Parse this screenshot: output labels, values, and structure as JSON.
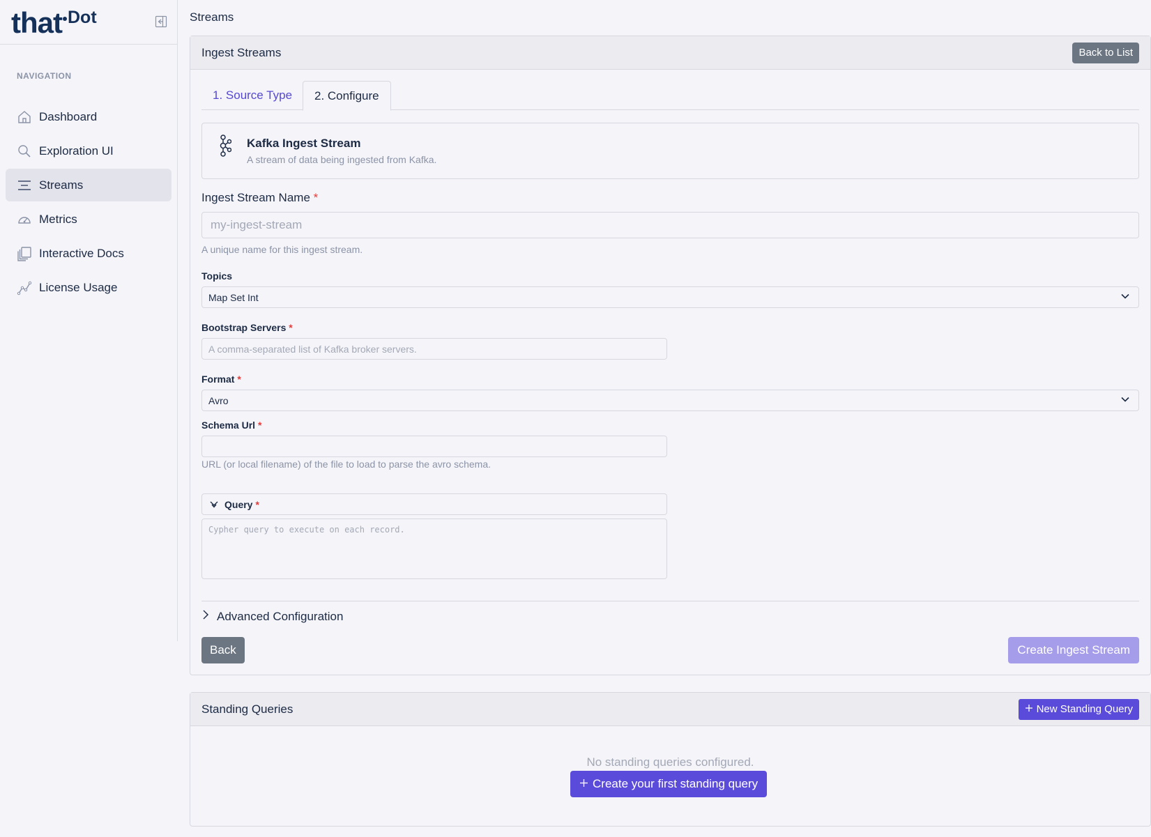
{
  "brand": {
    "logo_main": "that",
    "logo_sup": "Dot"
  },
  "sidebar": {
    "header": "NAVIGATION",
    "items": [
      {
        "label": "Dashboard",
        "icon": "home-icon",
        "active": false
      },
      {
        "label": "Exploration UI",
        "icon": "search-icon",
        "active": false
      },
      {
        "label": "Streams",
        "icon": "streams-icon",
        "active": true
      },
      {
        "label": "Metrics",
        "icon": "gauge-icon",
        "active": false
      },
      {
        "label": "Interactive Docs",
        "icon": "docs-icon",
        "active": false
      },
      {
        "label": "License Usage",
        "icon": "chart-line-icon",
        "active": false
      }
    ]
  },
  "breadcrumb": "Streams",
  "ingest": {
    "title": "Ingest Streams",
    "back_to_list": "Back to List",
    "tabs": [
      {
        "label": "1. Source Type"
      },
      {
        "label": "2. Configure"
      }
    ],
    "source": {
      "title": "Kafka Ingest Stream",
      "description": "A stream of data being ingested from Kafka."
    },
    "name_field": {
      "label": "Ingest Stream Name",
      "required_mark": "*",
      "placeholder": "my-ingest-stream",
      "help": "A unique name for this ingest stream."
    },
    "topics": {
      "label": "Topics",
      "value": "Map Set Int"
    },
    "bootstrap": {
      "label": "Bootstrap Servers",
      "required_mark": "*",
      "placeholder": "A comma-separated list of Kafka broker servers."
    },
    "format": {
      "label": "Format",
      "required_mark": "*",
      "value": "Avro"
    },
    "schema_url": {
      "label": "Schema Url",
      "required_mark": "*",
      "value": "",
      "help": "URL (or local filename) of the file to load to parse the avro schema."
    },
    "query": {
      "label": "Query",
      "required_mark": "*",
      "placeholder": "Cypher query to execute on each record."
    },
    "advanced": "Advanced Configuration",
    "back_button": "Back",
    "create_button": "Create Ingest Stream"
  },
  "standing": {
    "title": "Standing Queries",
    "new_button": "New Standing Query",
    "empty_message": "No standing queries configured.",
    "create_first": "Create your first standing query"
  },
  "colors": {
    "accent": "#5b4bdb",
    "accent_disabled": "#a59cea",
    "secondary": "#6c7683",
    "required": "#e23b3b"
  }
}
